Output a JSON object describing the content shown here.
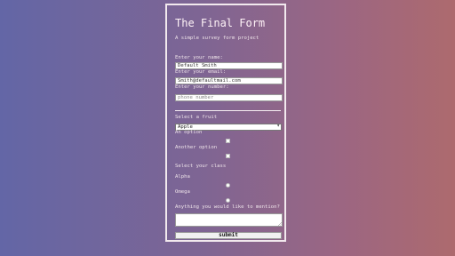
{
  "form": {
    "title": "The Final Form",
    "subtitle": "A simple survey form project",
    "name_label": "Enter your name:",
    "name_value": "Default Smith",
    "email_label": "Enter your email:",
    "email_value": "Smith@defaultmail.com",
    "number_label": "Enter your number:",
    "number_placeholder": "phone number",
    "fruit_label": "Select a fruit",
    "fruit_selected": "Apple",
    "option1_label": "An option",
    "option2_label": "Another option",
    "class_label": "Select your class",
    "class_option1": "Alpha",
    "class_option2": "Omega",
    "mention_label": "Anything you would like to mention?",
    "submit_label": "submit"
  },
  "icons": {
    "select_arrow": "chevron-down-icon"
  },
  "colors": {
    "gradient_left": "#6366a6",
    "gradient_right": "#ad6a6e",
    "card_border": "#f2e9ee"
  }
}
